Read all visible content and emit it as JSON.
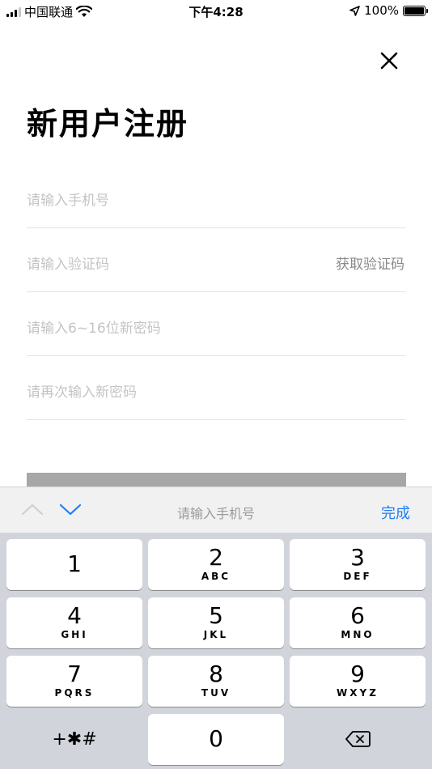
{
  "status_bar": {
    "carrier": "中国联通",
    "time": "下午4:28",
    "battery": "100%",
    "icons": [
      "signal-bars-icon",
      "wifi-icon",
      "location-arrow-icon",
      "battery-icon"
    ]
  },
  "header": {
    "close_icon": "close-icon",
    "title": "新用户注册"
  },
  "form": {
    "phone_placeholder": "请输入手机号",
    "code_placeholder": "请输入验证码",
    "get_code_label": "获取验证码",
    "password_placeholder": "请输入6~16位新密码",
    "confirm_placeholder": "请再次输入新密码"
  },
  "keyboard_toolbar": {
    "prev_icon": "chevron-up-icon",
    "next_icon": "chevron-down-icon",
    "field_label": "请输入手机号",
    "done_label": "完成",
    "accent_color": "#1e7ef5"
  },
  "keypad": {
    "keys": [
      {
        "num": "1",
        "letters": ""
      },
      {
        "num": "2",
        "letters": "ABC"
      },
      {
        "num": "3",
        "letters": "DEF"
      },
      {
        "num": "4",
        "letters": "GHI"
      },
      {
        "num": "5",
        "letters": "JKL"
      },
      {
        "num": "6",
        "letters": "MNO"
      },
      {
        "num": "7",
        "letters": "PQRS"
      },
      {
        "num": "8",
        "letters": "TUV"
      },
      {
        "num": "9",
        "letters": "WXYZ"
      },
      {
        "num": "+✱#",
        "letters": ""
      },
      {
        "num": "0",
        "letters": ""
      }
    ],
    "delete_icon": "backspace-icon"
  }
}
